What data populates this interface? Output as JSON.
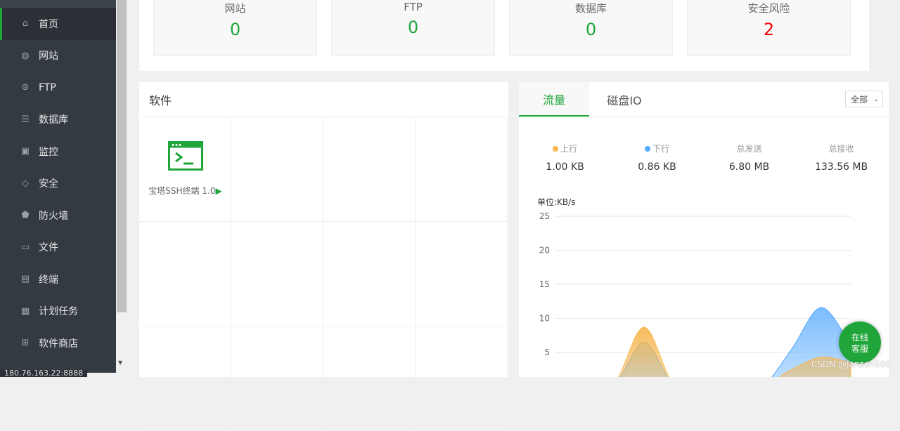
{
  "sidebar": {
    "items": [
      {
        "label": "首页",
        "icon": "home-icon"
      },
      {
        "label": "网站",
        "icon": "globe-icon"
      },
      {
        "label": "FTP",
        "icon": "ftp-icon"
      },
      {
        "label": "数据库",
        "icon": "database-icon"
      },
      {
        "label": "监控",
        "icon": "monitor-icon"
      },
      {
        "label": "安全",
        "icon": "shield-check-icon"
      },
      {
        "label": "防火墙",
        "icon": "firewall-icon"
      },
      {
        "label": "文件",
        "icon": "folder-icon"
      },
      {
        "label": "终端",
        "icon": "terminal-icon"
      },
      {
        "label": "计划任务",
        "icon": "calendar-icon"
      },
      {
        "label": "软件商店",
        "icon": "apps-icon"
      }
    ],
    "address": "180.76.163.22:8888"
  },
  "stats": [
    {
      "label": "网站",
      "value": "0"
    },
    {
      "label": "FTP",
      "value": "0"
    },
    {
      "label": "数据库",
      "value": "0"
    },
    {
      "label": "安全风险",
      "value": "2",
      "color": "#ff0000"
    }
  ],
  "software": {
    "title": "软件",
    "items": [
      {
        "name": "宝塔SSH终端 1.0"
      }
    ]
  },
  "traffic": {
    "tabs": [
      "流量",
      "磁盘IO"
    ],
    "select": "全部",
    "metrics": [
      {
        "label": "上行",
        "value": "1.00 KB",
        "color": "#f7b851"
      },
      {
        "label": "下行",
        "value": "0.86 KB",
        "color": "#52a9ff"
      },
      {
        "label": "总发送",
        "value": "6.80 MB"
      },
      {
        "label": "总接收",
        "value": "133.56 MB"
      }
    ],
    "unit": "单位:KB/s"
  },
  "chart_data": {
    "type": "area",
    "ylabel": "单位:KB/s",
    "ylim": [
      0,
      25
    ],
    "yticks": [
      "25",
      "20",
      "15",
      "10",
      "5"
    ],
    "grid": true,
    "series": [
      {
        "name": "上行",
        "color": "#f7b851",
        "values": [
          0,
          0,
          0.5,
          8.7,
          0.3,
          0,
          0,
          0,
          2.5,
          4.3,
          3.5
        ]
      },
      {
        "name": "下行",
        "color": "#52a9ff",
        "values": [
          0,
          0,
          0.3,
          6.5,
          0.2,
          0,
          0,
          0,
          5.5,
          11.6,
          6
        ]
      }
    ]
  },
  "support": {
    "label1": "在线",
    "label2": "客服"
  },
  "watermark": "CSDN @Janson666"
}
